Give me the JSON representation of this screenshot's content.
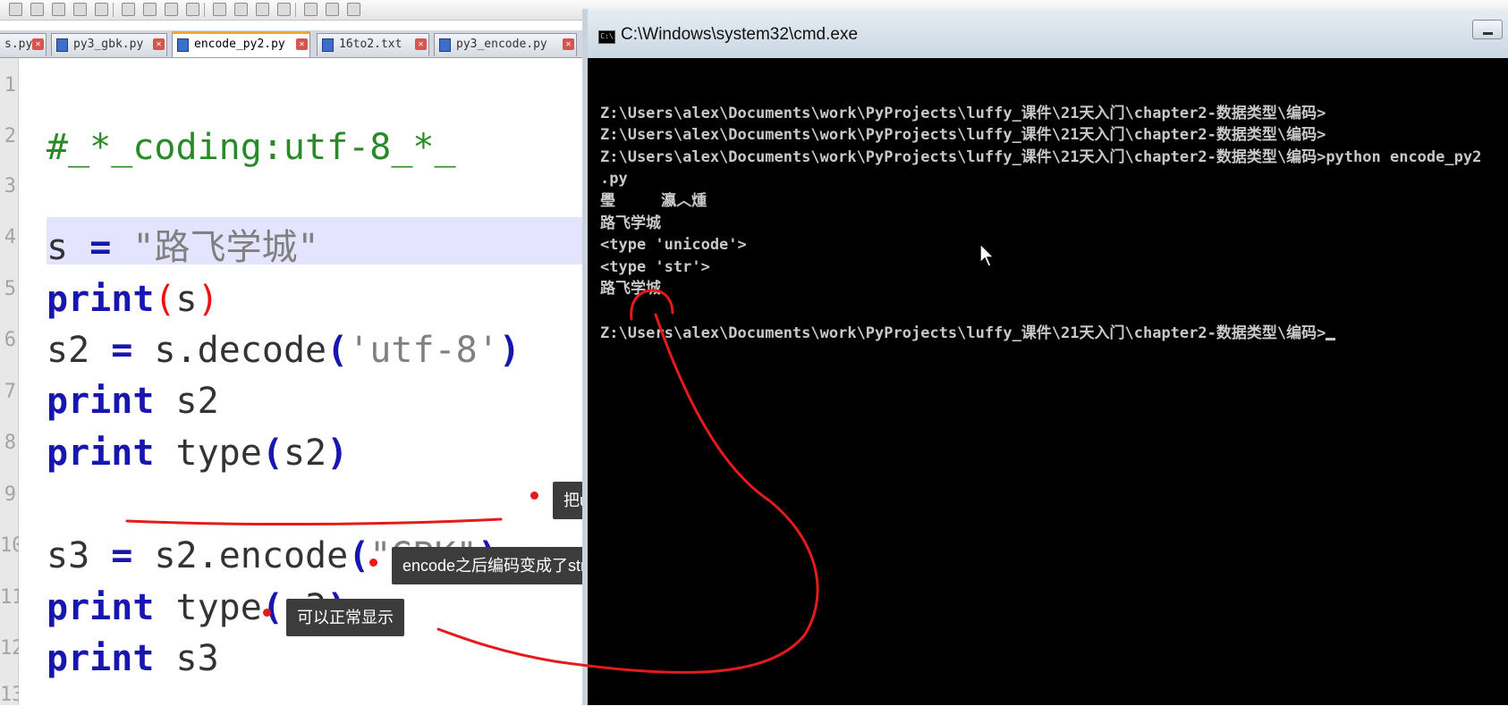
{
  "toolbar": {
    "icons": [
      "new-icon",
      "open-icon",
      "save-icon",
      "print-icon",
      "cut-icon",
      "copy-icon",
      "paste-icon",
      "undo-icon",
      "redo-icon",
      "find-icon",
      "replace-icon",
      "zoom-in-icon",
      "zoom-out-icon",
      "sync-icon",
      "wrap-icon",
      "indent-icon"
    ]
  },
  "tabs": [
    {
      "label": "s.py"
    },
    {
      "label": "py3_gbk.py"
    },
    {
      "label": "encode_py2.py"
    },
    {
      "label": "16to2.txt"
    },
    {
      "label": "py3_encode.py"
    }
  ],
  "editor": {
    "line_numbers": [
      "1",
      "2",
      "3",
      "4",
      "5",
      "6",
      "7",
      "8",
      "9",
      "10",
      "11",
      "12",
      "13"
    ],
    "line1": "#_*_coding:utf-8_*_",
    "line3_var": "s",
    "line3_eq": "=",
    "line3_str": "\"路飞学城\"",
    "line4_kw": "print",
    "line4_open": "(",
    "line4_arg": "s",
    "line4_close": ")",
    "line5_var": "s2",
    "line5_eq": "=",
    "line5_call": "s.decode",
    "line5_open": "(",
    "line5_str": "'utf-8'",
    "line5_close": ")",
    "line6_kw": "print",
    "line6_arg": "s2",
    "line7_kw": "print",
    "line7_call": "type",
    "line7_open": "(",
    "line7_arg": "s2",
    "line7_close": ")",
    "line9_var": "s3",
    "line9_eq": "=",
    "line9_call": "s2.encode",
    "line9_open": "(",
    "line9_str": "\"GBK\"",
    "line9_close": ")",
    "line10_kw": "print",
    "line10_call": "type",
    "line10_open": "(",
    "line10_arg": "s3",
    "line10_close": ")",
    "line11_kw": "print",
    "line11_arg": "s3"
  },
  "tooltips": {
    "encode_note": "把unicode编码成gbk",
    "type_note": "encode之后编码变成了str",
    "print_note": "可以正常显示"
  },
  "cmd": {
    "title": "C:\\Windows\\system32\\cmd.exe",
    "icon_text": "C:\\",
    "lines": [
      "",
      "Z:\\Users\\alex\\Documents\\work\\PyProjects\\luffy_课件\\21天入门\\chapter2-数据类型\\编码>",
      "Z:\\Users\\alex\\Documents\\work\\PyProjects\\luffy_课件\\21天入门\\chapter2-数据类型\\编码>",
      "Z:\\Users\\alex\\Documents\\work\\PyProjects\\luffy_课件\\21天入门\\chapter2-数据类型\\编码>python encode_py2",
      ".py",
      "璺     瀛︿煄",
      "路飞学城",
      "<type 'unicode'>",
      "<type 'str'>",
      "路飞学城",
      "",
      "Z:\\Users\\alex\\Documents\\work\\PyProjects\\luffy_课件\\21天入门\\chapter2-数据类型\\编码>"
    ]
  },
  "colors": {
    "keyword": "#1717b0",
    "string": "#808080",
    "annotation_red": "#e41b1b",
    "tab_active_accent": "#f3a43a",
    "cmd_bg": "#000000",
    "cmd_text": "#c8c8c8"
  }
}
